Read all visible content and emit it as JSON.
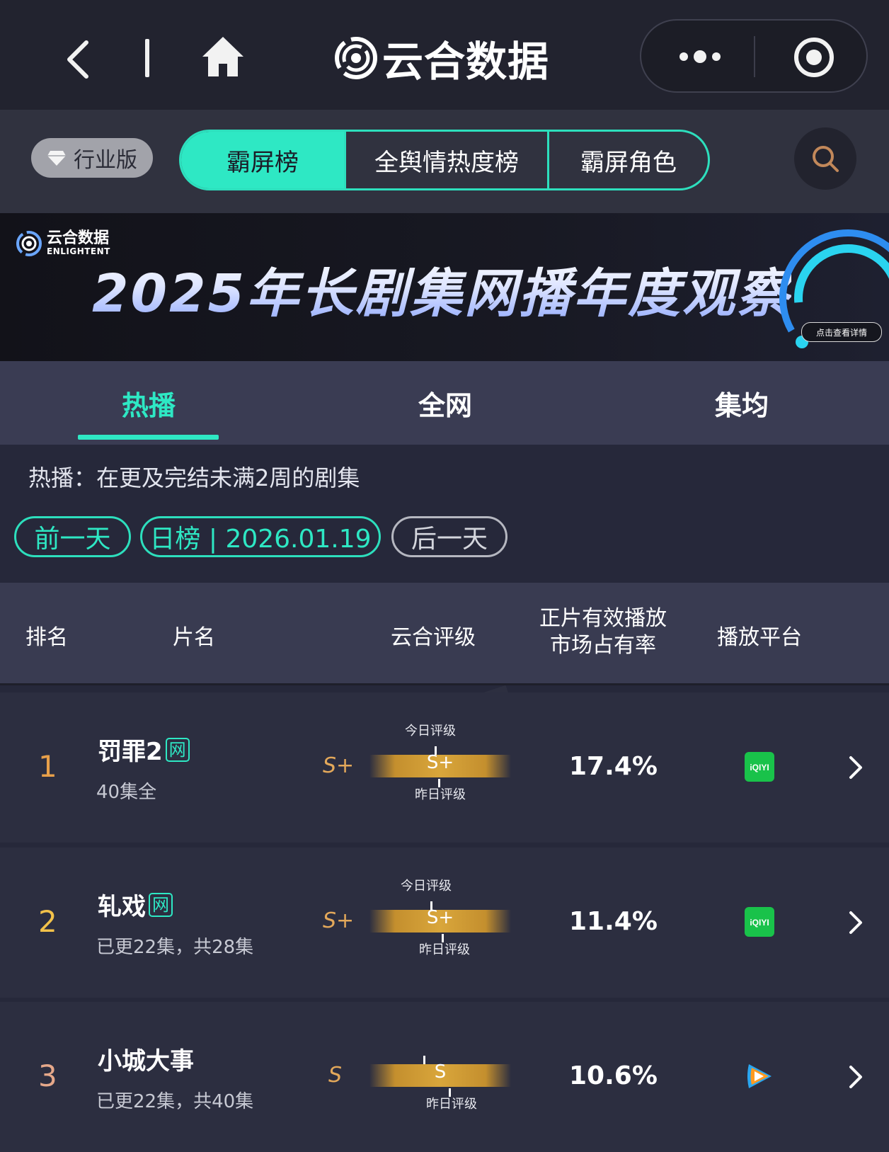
{
  "app": {
    "title": "云合数据"
  },
  "edition": {
    "label": "行业版"
  },
  "segments": [
    {
      "label": "霸屏榜",
      "active": true
    },
    {
      "label": "全舆情热度榜",
      "active": false
    },
    {
      "label": "霸屏角色",
      "active": false
    }
  ],
  "banner": {
    "logo_text": "云合数据",
    "logo_sub": "ENLIGHTENT",
    "title": "2025年长剧集网播年度观察",
    "cta": "点击查看详情"
  },
  "subtabs": [
    {
      "label": "热播",
      "active": true
    },
    {
      "label": "全网",
      "active": false
    },
    {
      "label": "集均",
      "active": false
    }
  ],
  "info": {
    "text": "热播：在更及完结未满2周的剧集"
  },
  "date_nav": {
    "prev": "前一天",
    "current": "日榜 | 2026.01.19",
    "next": "后一天"
  },
  "table": {
    "headers": {
      "rank": "排名",
      "title": "片名",
      "grade": "云合评级",
      "share_line1": "正片有效播放",
      "share_line2": "市场占有率",
      "platform": "播放平台"
    },
    "rows": [
      {
        "rank": "1",
        "title": "罚罪2",
        "tag": "网",
        "episodes": "40集全",
        "grade_left": "S+",
        "today_label": "今日评级",
        "grade": "S+",
        "yesterday_label": "昨日评级",
        "share": "17.4%",
        "platform_icon": "iqiyi-icon",
        "platform_text": "iQIYI"
      },
      {
        "rank": "2",
        "title": "轧戏",
        "tag": "网",
        "episodes": "已更22集，共28集",
        "grade_left": "S+",
        "today_label": "今日评级",
        "grade": "S+",
        "yesterday_label": "昨日评级",
        "share": "11.4%",
        "platform_icon": "iqiyi-icon",
        "platform_text": "iQIYI"
      },
      {
        "rank": "3",
        "title": "小城大事",
        "tag": "",
        "episodes": "已更22集，共40集",
        "grade_left": "S",
        "today_label": "",
        "grade": "S",
        "yesterday_label": "昨日评级",
        "share": "10.6%",
        "platform_icon": "tencent-video-icon",
        "platform_text": ""
      }
    ]
  },
  "colors": {
    "accent": "#2ee8c4",
    "gold": "#d9a63b",
    "rank_orange": "#e8a04a"
  }
}
